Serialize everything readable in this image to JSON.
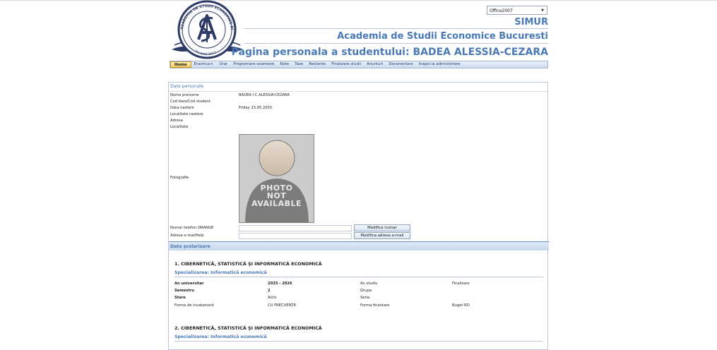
{
  "header": {
    "theme_selector": "Office2007",
    "app_name": "SIMUR",
    "institution": "Academia de Studii Economice Bucuresti",
    "page_title": "Pagina personala a studentului: BADEA ALESSIA-CEZARA"
  },
  "logo": {
    "text_top": "ACADEMIA DE STUDII ECONOMICE DIN BUCURESTI",
    "text_bottom": "Fondată 1913"
  },
  "nav": {
    "items": [
      "Home",
      "Erasmus+",
      "Orar",
      "Programare examene",
      "Note",
      "Taxe",
      "Restante",
      "Finalizare studii",
      "Anunturi",
      "Deconectare",
      "Inapoi la administrare"
    ],
    "active": "Home"
  },
  "personal": {
    "section_title": "Date personale",
    "labels": {
      "name": "Nume prenume",
      "barcode": "Cod bare/Cod student",
      "birth_date": "Data nastere",
      "birth_place": "Localitate nastere",
      "address": "Adresa",
      "locality": "Localitate",
      "photo": "Fotografie",
      "phone": "Numar telefon ORANGE",
      "email": "Adresa e-mailHelp"
    },
    "values": {
      "name": "BADEA I C ALESSIA-CEZARA",
      "birth_date": "Friday 23.05.2003"
    },
    "photo_placeholder": [
      "PHOTO",
      "NOT",
      "AVAILABLE"
    ],
    "buttons": {
      "modify_phone": "Modifica numar",
      "modify_email": "Modifica adresa e-mail"
    }
  },
  "schooling": {
    "section_title": "Date şcolarizare",
    "entries": [
      {
        "faculty": "1. CIBERNETICĂ, STATISTICĂ ŞI INFORMATICĂ ECONOMICĂ",
        "specialization": "Specializarea: Informatică economică",
        "labels": {
          "year": "An universitar",
          "semester": "Semestru",
          "status": "Stare",
          "form": "Forma de invatamant",
          "study_year": "An studiu",
          "group": "Grupa",
          "series": "Seria",
          "financing": "Forma finantare",
          "completion": "Finalizare"
        },
        "values": {
          "year": "2025 - 2026",
          "semester": "2",
          "status": "Activ",
          "form": "CU FRECVENŢĂ",
          "financing": "Buget RO"
        }
      },
      {
        "faculty": "2. CIBERNETICĂ, STATISTICĂ ŞI INFORMATICĂ ECONOMICĂ",
        "specialization": "Specializarea: Informatică economică"
      }
    ]
  },
  "colors": {
    "accent": "#4a79b8",
    "nav_active": "#f7c85c",
    "border": "#b8c7da"
  }
}
